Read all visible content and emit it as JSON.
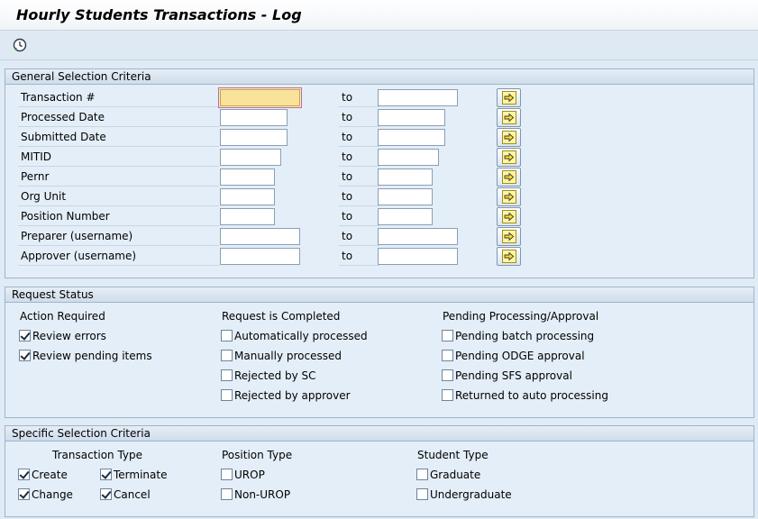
{
  "window": {
    "title": "Hourly Students Transactions - Log"
  },
  "toolbar": {
    "execute_icon": "clock-execute-icon"
  },
  "general": {
    "header": "General Selection Criteria",
    "to_label": "to",
    "rows": [
      {
        "label": "Transaction #",
        "from": "",
        "to": ""
      },
      {
        "label": "Processed Date",
        "from": "",
        "to": ""
      },
      {
        "label": "Submitted Date",
        "from": "",
        "to": ""
      },
      {
        "label": "MITID",
        "from": "",
        "to": ""
      },
      {
        "label": "Pernr",
        "from": "",
        "to": ""
      },
      {
        "label": "Org Unit",
        "from": "",
        "to": ""
      },
      {
        "label": "Position Number",
        "from": "",
        "to": ""
      },
      {
        "label": "Preparer (username)",
        "from": "",
        "to": ""
      },
      {
        "label": "Approver (username)",
        "from": "",
        "to": ""
      }
    ],
    "multi_icon": "arrow-right-multiple-selection-icon"
  },
  "request_status": {
    "header": "Request Status",
    "columns": [
      {
        "title": "Action Required",
        "items": [
          {
            "label": "Review errors",
            "checked": true
          },
          {
            "label": "Review pending items",
            "checked": true
          }
        ]
      },
      {
        "title": "Request is Completed",
        "items": [
          {
            "label": "Automatically processed",
            "checked": false
          },
          {
            "label": "Manually processed",
            "checked": false
          },
          {
            "label": "Rejected by SC",
            "checked": false
          },
          {
            "label": "Rejected by approver",
            "checked": false
          }
        ]
      },
      {
        "title": "Pending Processing/Approval",
        "items": [
          {
            "label": "Pending batch processing",
            "checked": false
          },
          {
            "label": "Pending ODGE approval",
            "checked": false
          },
          {
            "label": "Pending SFS approval",
            "checked": false
          },
          {
            "label": "Returned to auto processing",
            "checked": false
          }
        ]
      }
    ]
  },
  "specific": {
    "header": "Specific Selection Criteria",
    "transaction_type": {
      "title": "Transaction Type",
      "items": [
        {
          "label": "Create",
          "checked": true
        },
        {
          "label": "Terminate",
          "checked": true
        },
        {
          "label": "Change",
          "checked": true
        },
        {
          "label": "Cancel",
          "checked": true
        }
      ]
    },
    "position_type": {
      "title": "Position Type",
      "items": [
        {
          "label": "UROP",
          "checked": false
        },
        {
          "label": "Non-UROP",
          "checked": false
        }
      ]
    },
    "student_type": {
      "title": "Student Type",
      "items": [
        {
          "label": "Graduate",
          "checked": false
        },
        {
          "label": "Undergraduate",
          "checked": false
        }
      ]
    }
  }
}
